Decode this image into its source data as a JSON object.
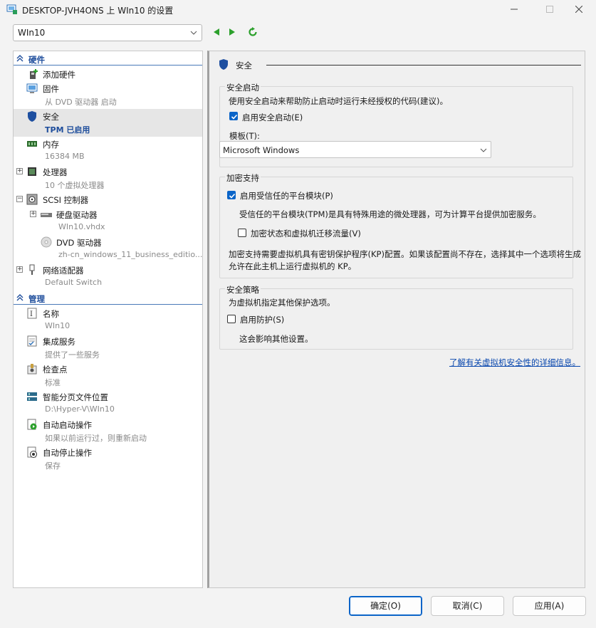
{
  "window": {
    "title": "DESKTOP-JVH4ONS 上 WIn10 的设置"
  },
  "toolbar": {
    "vm_selected": "WIn10"
  },
  "hardware": {
    "header": "硬件",
    "add_hardware": "添加硬件",
    "firmware": {
      "label": "固件",
      "sub": "从 DVD 驱动器 启动"
    },
    "security": {
      "label": "安全",
      "sub": "TPM 已启用"
    },
    "memory": {
      "label": "内存",
      "sub": "16384 MB"
    },
    "processor": {
      "label": "处理器",
      "sub": "10 个虚拟处理器"
    },
    "scsi": {
      "label": "SCSI 控制器"
    },
    "hard_drive": {
      "label": "硬盘驱动器",
      "sub": "WIn10.vhdx"
    },
    "dvd": {
      "label": "DVD 驱动器",
      "sub": "zh-cn_windows_11_business_editio..."
    },
    "network": {
      "label": "网络适配器",
      "sub": "Default Switch"
    }
  },
  "management": {
    "header": "管理",
    "name": {
      "label": "名称",
      "sub": "WIn10"
    },
    "integration": {
      "label": "集成服务",
      "sub": "提供了一些服务"
    },
    "checkpoints": {
      "label": "检查点",
      "sub": "标准"
    },
    "paging": {
      "label": "智能分页文件位置",
      "sub": "D:\\Hyper-V\\WIn10"
    },
    "autostart": {
      "label": "自动启动操作",
      "sub": "如果以前运行过，则重新启动"
    },
    "autostop": {
      "label": "自动停止操作",
      "sub": "保存"
    }
  },
  "security_panel": {
    "header": "安全",
    "secure_boot": {
      "title": "安全启动",
      "description": "使用安全启动来帮助防止启动时运行未经授权的代码(建议)。",
      "enable_label": "启用安全启动(E)",
      "enabled": true,
      "template_label": "模板(T):",
      "template_value": "Microsoft Windows"
    },
    "encryption": {
      "title": "加密支持",
      "tpm_label": "启用受信任的平台模块(P)",
      "tpm_enabled": true,
      "tpm_description": "受信任的平台模块(TPM)是具有特殊用途的微处理器，可为计算平台提供加密服务。",
      "encrypt_label": "加密状态和虚拟机迁移流量(V)",
      "encrypt_enabled": false,
      "kp_note_line1": "加密支持需要虚拟机具有密钥保护程序(KP)配置。如果该配置尚不存在，选择其中一个选项将生成",
      "kp_note_line2": "允许在此主机上运行虚拟机的 KP。"
    },
    "policy": {
      "title": "安全策略",
      "description": "为虚拟机指定其他保护选项。",
      "shielding_label": "启用防护(S)",
      "shielding_enabled": false,
      "note": "这会影响其他设置。"
    },
    "learn_more": "了解有关虚拟机安全性的详细信息。"
  },
  "buttons": {
    "ok": "确定(O)",
    "cancel": "取消(C)",
    "apply": "应用(A)"
  },
  "colors": {
    "accent": "#0a64c8",
    "section_header": "#1f4e9c",
    "link": "#0645ad"
  }
}
